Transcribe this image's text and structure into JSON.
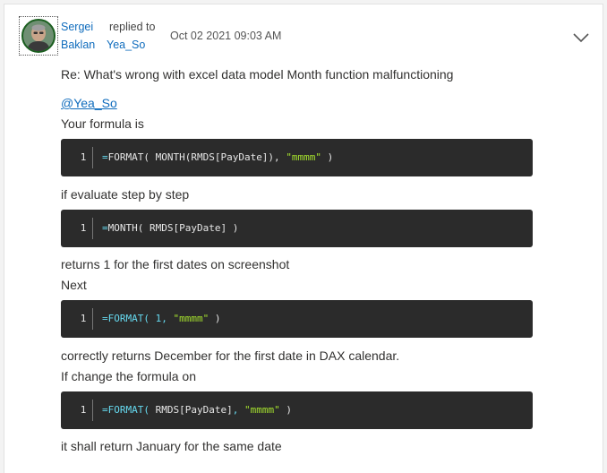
{
  "post": {
    "author": {
      "first_name": "Sergei",
      "last_name": "Baklan"
    },
    "replied_label": "replied to",
    "replied_user": "Yea_So",
    "timestamp": "Oct 02 2021 09:03 AM",
    "subject": "Re: What's wrong with excel data model Month function malfunctioning",
    "mention": "@Yea_So",
    "paragraphs": [
      "Your formula is",
      "if evaluate step by step",
      "returns 1 for the first dates on screenshot",
      "Next",
      "correctly returns December for the first date in DAX calendar.",
      "If change the formula on",
      "it shall return January for the same date"
    ],
    "code_blocks": [
      {
        "line_number": "1",
        "tokens": [
          {
            "text": "=",
            "kind": "op"
          },
          {
            "text": "FORMAT( MONTH(RMDS[PayDate]), ",
            "kind": "fn"
          },
          {
            "text": "\"mmmm\"",
            "kind": "str"
          },
          {
            "text": " )",
            "kind": "fn"
          }
        ]
      },
      {
        "line_number": "1",
        "tokens": [
          {
            "text": "=",
            "kind": "op"
          },
          {
            "text": "MONTH( RMDS[PayDate] )",
            "kind": "fn"
          }
        ]
      },
      {
        "line_number": "1",
        "tokens": [
          {
            "text": "=",
            "kind": "op"
          },
          {
            "text": "FORMAT( ",
            "kind": "op"
          },
          {
            "text": "1",
            "kind": "num"
          },
          {
            "text": ", ",
            "kind": "op"
          },
          {
            "text": "\"mmmm\"",
            "kind": "str"
          },
          {
            "text": " )",
            "kind": "fn"
          }
        ]
      },
      {
        "line_number": "1",
        "tokens": [
          {
            "text": "=",
            "kind": "op"
          },
          {
            "text": "FORMAT( ",
            "kind": "op"
          },
          {
            "text": "RMDS[PayDate]",
            "kind": "fn"
          },
          {
            "text": ", ",
            "kind": "op"
          },
          {
            "text": "\"mmmm\"",
            "kind": "str"
          },
          {
            "text": " )",
            "kind": "fn"
          }
        ]
      }
    ],
    "icons": {
      "avatar": "user-avatar",
      "menu": "chevron-down-icon"
    },
    "colors": {
      "link": "#0f6cbd",
      "code_bg": "#2b2b2b",
      "code_keyword": "#66d9ef",
      "code_string": "#a6e22e"
    }
  }
}
